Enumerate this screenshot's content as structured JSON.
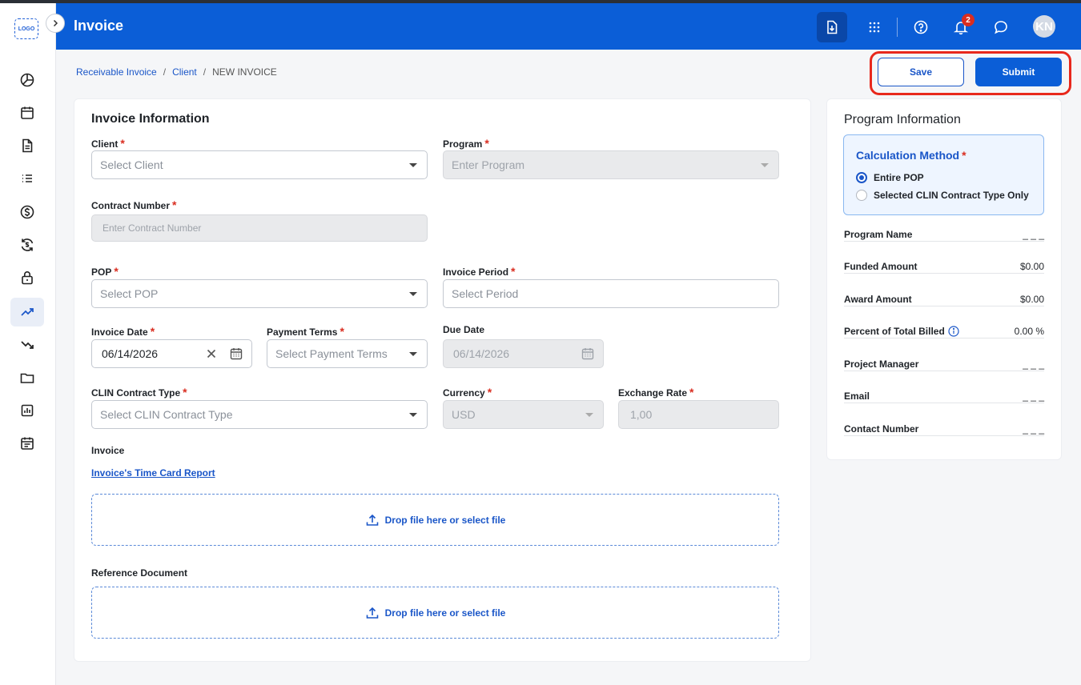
{
  "header": {
    "title": "Invoice",
    "notification_count": "2",
    "avatar_initials": "KN"
  },
  "rail": {
    "logo_text": "LOGO",
    "items": [
      "dashboard-icon",
      "calendar-icon",
      "document-icon",
      "list-icon",
      "dollar-icon",
      "exchange-icon",
      "lock-icon",
      "trend-up-icon",
      "trend-down-icon",
      "folder-icon",
      "report-icon",
      "schedule-icon"
    ],
    "active_item": "trend-up-icon"
  },
  "breadcrumb": {
    "items": [
      "Receivable Invoice",
      "Client"
    ],
    "current": "NEW INVOICE"
  },
  "actions": {
    "save_label": "Save",
    "submit_label": "Submit",
    "highlight_color": "#e8281c"
  },
  "form": {
    "section_title": "Invoice Information",
    "client": {
      "label": "Client",
      "placeholder": "Select Client"
    },
    "program": {
      "label": "Program",
      "placeholder": "Enter Program"
    },
    "contract_number": {
      "label": "Contract Number",
      "placeholder": "Enter Contract Number"
    },
    "pop": {
      "label": "POP",
      "placeholder": "Select POP"
    },
    "invoice_period": {
      "label": "Invoice Period",
      "placeholder": "Select Period"
    },
    "invoice_date": {
      "label": "Invoice Date",
      "value": "06/14/2026"
    },
    "payment_terms": {
      "label": "Payment Terms",
      "placeholder": "Select Payment Terms"
    },
    "due_date": {
      "label": "Due Date",
      "value": "06/14/2026"
    },
    "clin_contract_type": {
      "label": "CLIN Contract Type",
      "placeholder": "Select CLIN Contract Type"
    },
    "currency": {
      "label": "Currency",
      "value": "USD"
    },
    "exchange_rate": {
      "label": "Exchange Rate",
      "value": "1,00"
    },
    "invoice_section_label": "Invoice",
    "time_card_link": "Invoice's Time Card Report",
    "dropzone_text": "Drop file here or select file",
    "reference_label": "Reference Document",
    "reference_dropzone_text": "Drop file here or select file"
  },
  "program_info": {
    "title": "Program Information",
    "calculation_method": {
      "label": "Calculation Method",
      "options": [
        "Entire POP",
        "Selected CLIN Contract Type Only"
      ],
      "selected": "Entire POP"
    },
    "rows": [
      {
        "label": "Program Name",
        "value": "_ _ _"
      },
      {
        "label": "Funded Amount",
        "value": "$0.00"
      },
      {
        "label": "Award Amount",
        "value": "$0.00"
      },
      {
        "label": "Percent of Total Billed",
        "value": "0.00 %"
      },
      {
        "label": "Project Manager",
        "value": "_ _ _"
      },
      {
        "label": "Email",
        "value": "_ _ _"
      },
      {
        "label": "Contact Number",
        "value": "_ _ _"
      }
    ]
  },
  "colors": {
    "brand": "#0b5ed7",
    "required": "#d92d20",
    "link": "#1a56c8"
  }
}
